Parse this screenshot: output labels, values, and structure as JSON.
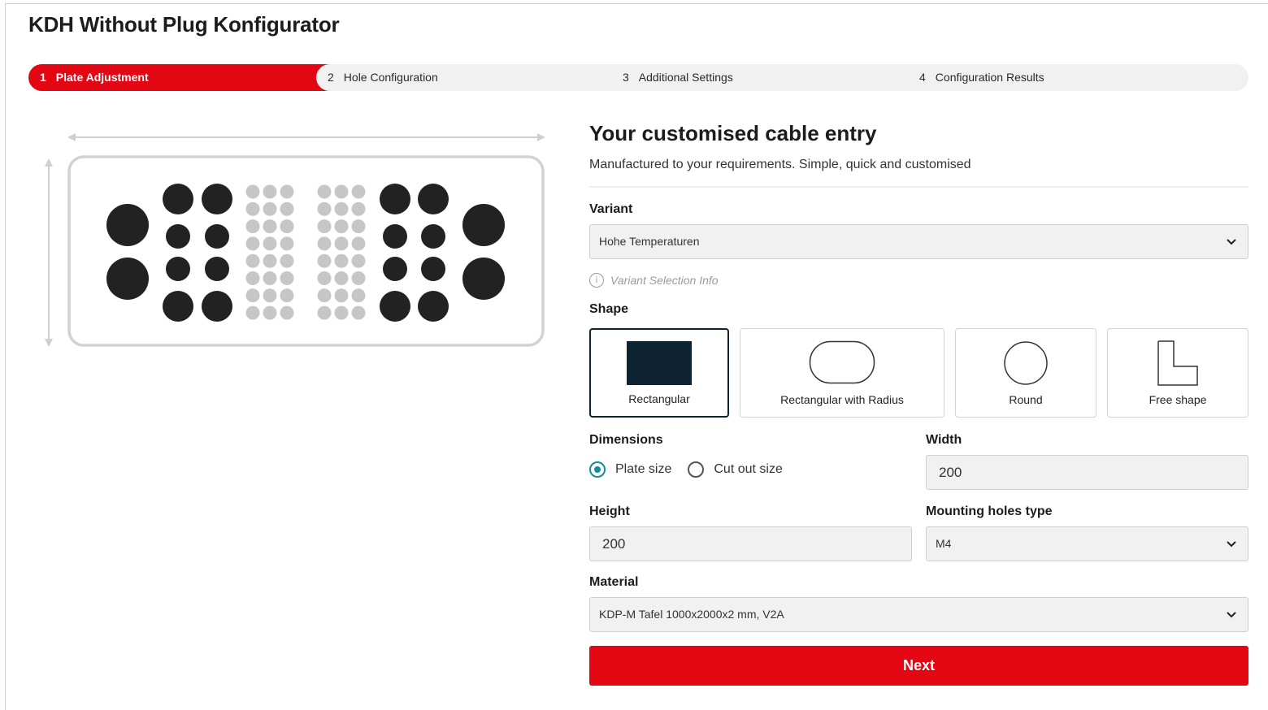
{
  "app": {
    "title": "KDH Without Plug Konfigurator"
  },
  "stepper": {
    "steps": [
      {
        "num": "1",
        "label": "Plate Adjustment"
      },
      {
        "num": "2",
        "label": "Hole Configuration"
      },
      {
        "num": "3",
        "label": "Additional Settings"
      },
      {
        "num": "4",
        "label": "Configuration Results"
      }
    ]
  },
  "form": {
    "heading": "Your customised cable entry",
    "subtitle": "Manufactured to your requirements. Simple, quick and customised",
    "variant": {
      "label": "Variant",
      "value": "Hohe Temperaturen",
      "info": "Variant Selection Info"
    },
    "shape": {
      "label": "Shape",
      "options": [
        "Rectangular",
        "Rectangular with Radius",
        "Round",
        "Free shape"
      ],
      "selected": "Rectangular"
    },
    "dimensions": {
      "label": "Dimensions",
      "options": [
        "Plate size",
        "Cut out size"
      ],
      "selected": "Plate size"
    },
    "width": {
      "label": "Width",
      "value": "200"
    },
    "height": {
      "label": "Height",
      "value": "200"
    },
    "mounting_holes": {
      "label": "Mounting holes type",
      "value": "M4"
    },
    "material": {
      "label": "Material",
      "value": "KDP-M Tafel 1000x2000x2 mm, V2A"
    },
    "next_label": "Next"
  },
  "colors": {
    "accent": "#e30613",
    "selected_border": "#0f2433",
    "radio": "#0f8ea0"
  }
}
